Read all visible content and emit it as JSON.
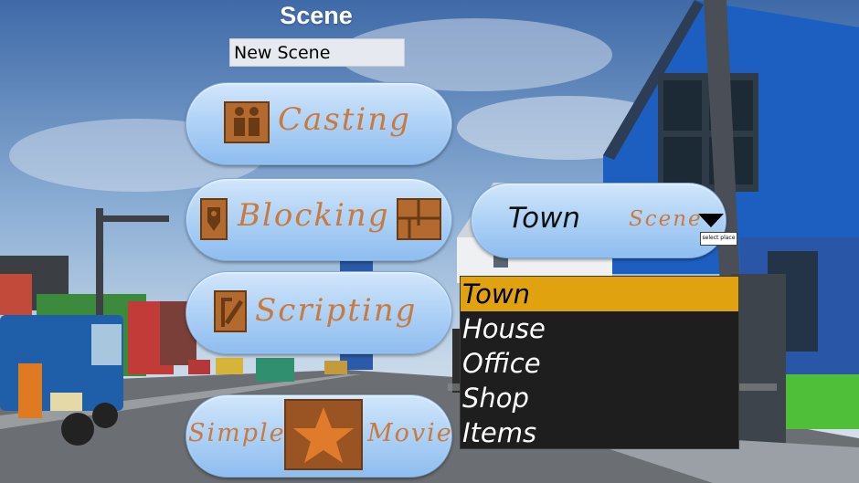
{
  "header": {
    "title": "Scene",
    "scene_name_value": "New Scene"
  },
  "menu": {
    "casting_label": "Casting",
    "blocking_label": "Blocking",
    "scripting_label": "Scripting",
    "simple_label": "Simple",
    "movie_label": "Movie"
  },
  "place_dropdown": {
    "selected": "Town",
    "caption": "Scene",
    "tooltip": "select place",
    "options": [
      "Town",
      "House",
      "Office",
      "Shop",
      "Items"
    ]
  },
  "colors": {
    "button_fill": "#b1d3f6",
    "script_text": "#c97a3e",
    "icon_fill": "#b36a2f",
    "list_background": "#1e1e1e",
    "list_selected": "#e0a30f"
  }
}
